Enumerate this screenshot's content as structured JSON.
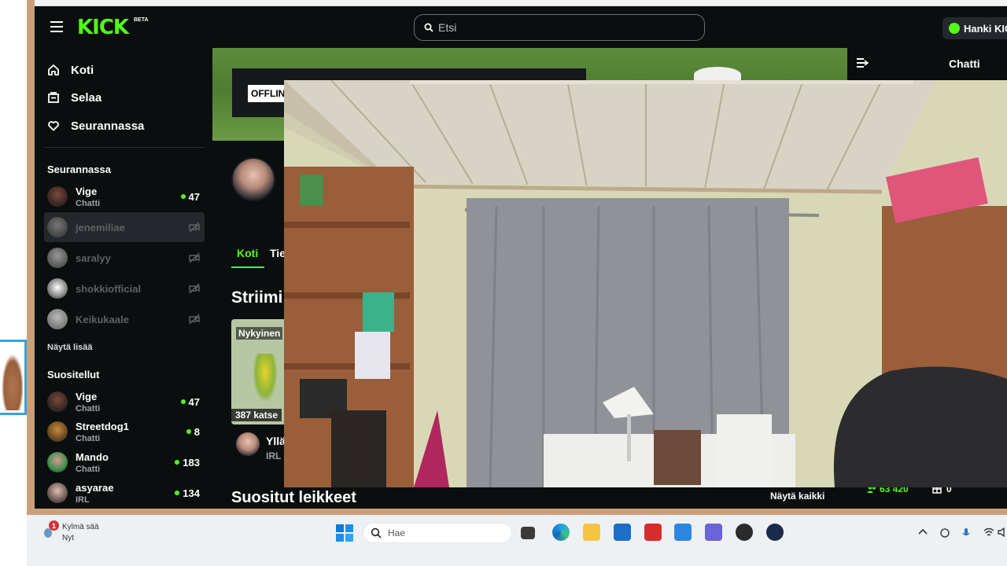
{
  "header": {
    "logo_text": "KICK",
    "logo_badge": "BETA",
    "search_placeholder": "Etsi",
    "get_kick_label": "Hanki KIC"
  },
  "sidebar": {
    "nav": [
      {
        "label": "Koti",
        "icon": "home-icon"
      },
      {
        "label": "Selaa",
        "icon": "browse-icon"
      },
      {
        "label": "Seurannassa",
        "icon": "heart-icon"
      }
    ],
    "following_title": "Seurannassa",
    "following": [
      {
        "name": "Vige",
        "category": "Chatti",
        "viewers": "47",
        "live": true
      },
      {
        "name": "jenemiliae",
        "category": "",
        "viewers": "",
        "live": false
      },
      {
        "name": "saralyy",
        "category": "",
        "viewers": "",
        "live": false
      },
      {
        "name": "shokkiofficial",
        "category": "",
        "viewers": "",
        "live": false
      },
      {
        "name": "Keikukaale",
        "category": "",
        "viewers": "",
        "live": false
      }
    ],
    "show_more_label": "Näytä lisää",
    "recommended_title": "Suositellut",
    "recommended": [
      {
        "name": "Vige",
        "category": "Chatti",
        "viewers": "47"
      },
      {
        "name": "Streetdog1",
        "category": "Chatti",
        "viewers": "8"
      },
      {
        "name": "Mando",
        "category": "Chatti",
        "viewers": "183"
      },
      {
        "name": "asyarae",
        "category": "IRL",
        "viewers": "134"
      }
    ]
  },
  "main": {
    "offline_badge": "OFFLINE",
    "tabs": [
      {
        "label": "Koti"
      },
      {
        "label": "Tie"
      }
    ],
    "streams_title": "Striimi",
    "stream_card": {
      "label": "Nykyinen",
      "viewers": "387 katse",
      "title": "Yllä",
      "category": "IRL"
    },
    "clips_title": "Suositut leikkeet",
    "show_all_label": "Näytä kaikki",
    "followers_count": "63 420",
    "gifts_count": "0"
  },
  "chat": {
    "title": "Chatti"
  },
  "taskbar": {
    "weather_label": "Kylmä sää",
    "weather_sub": "Nyt",
    "weather_badge": "1",
    "search_label": "Hae",
    "apps": [
      "task-view-icon",
      "edge-icon",
      "file-explorer-icon",
      "store-icon",
      "red-l-app-icon",
      "outlook-icon",
      "teams-icon",
      "obs-icon",
      "steam-icon"
    ]
  },
  "colors": {
    "accent": "#53fc18",
    "background": "#0b0e0f",
    "sidebar_active": "#24272c"
  }
}
